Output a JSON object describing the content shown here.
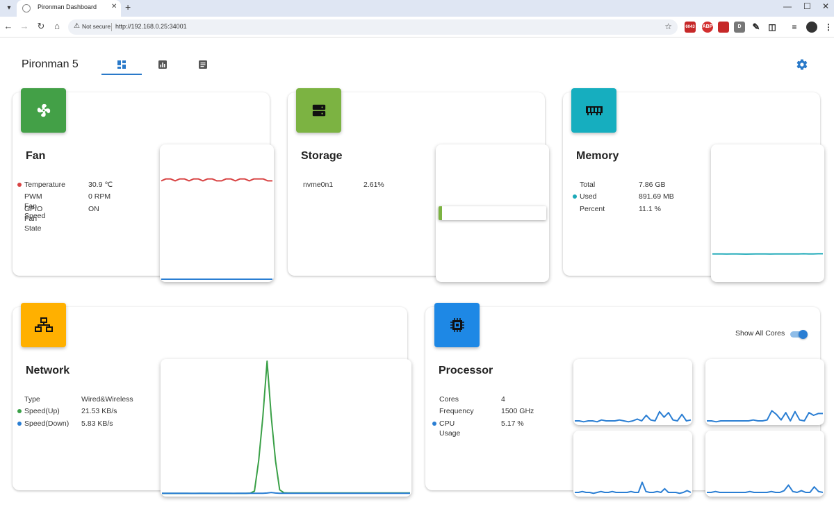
{
  "browser": {
    "tab_title": "Pironman Dashboard",
    "not_secure": "Not secure",
    "url": "http://192.168.0.25:34001",
    "extensions": [
      "6043",
      "ABP",
      "",
      "D"
    ]
  },
  "app": {
    "title": "Pironman 5",
    "nav_tabs": [
      "dashboard-icon",
      "chart-icon",
      "log-icon"
    ]
  },
  "fan": {
    "title": "Fan",
    "rows": [
      {
        "label": "Temperature",
        "value": "30.9 ℃",
        "dot": "#d84343"
      },
      {
        "label": "PWM Fan Speed",
        "value": "0 RPM",
        "dot": ""
      },
      {
        "label": "GPIO Fan State",
        "value": "ON",
        "dot": ""
      }
    ]
  },
  "storage": {
    "title": "Storage",
    "rows": [
      {
        "label": "nvme0n1",
        "value": "2.61%",
        "dot": ""
      }
    ],
    "usage_fraction": 0.0261
  },
  "memory": {
    "title": "Memory",
    "rows": [
      {
        "label": "Total",
        "value": "7.86 GB",
        "dot": ""
      },
      {
        "label": "Used",
        "value": "891.69 MB",
        "dot": "#1ca9b8"
      },
      {
        "label": "Percent",
        "value": "11.1 %",
        "dot": ""
      }
    ]
  },
  "network": {
    "title": "Network",
    "rows": [
      {
        "label": "Type",
        "value": "Wired&Wireless",
        "dot": ""
      },
      {
        "label": "Speed(Up)",
        "value": "21.53 KB/s",
        "dot": "#3aa047"
      },
      {
        "label": "Speed(Down)",
        "value": "5.83 KB/s",
        "dot": "#2a7ed3"
      }
    ]
  },
  "processor": {
    "title": "Processor",
    "rows": [
      {
        "label": "Cores",
        "value": "4",
        "dot": ""
      },
      {
        "label": "Frequency",
        "value": "1500 GHz",
        "dot": ""
      },
      {
        "label": "CPU Usage",
        "value": "5.17 %",
        "dot": "#2a7ed3"
      }
    ],
    "toggle_label": "Show All Cores",
    "show_all_cores": true
  },
  "colors": {
    "fan": "#43a047",
    "storage": "#7cb342",
    "memory": "#16aebf",
    "network": "#ffb000",
    "processor": "#1e88e5",
    "red": "#d84343",
    "blue": "#2a7ed3",
    "green": "#3aa047",
    "teal": "#1ca9b8",
    "accent": "#2979c9"
  },
  "chart_data": [
    {
      "type": "line",
      "name": "fan-temperature",
      "series": [
        {
          "color": "#d84343",
          "values": [
            49,
            50,
            50,
            49,
            50,
            50,
            49,
            50,
            50,
            49,
            50,
            50,
            49,
            49,
            50,
            50,
            49,
            50,
            50,
            49,
            50,
            50,
            50,
            49,
            49
          ]
        },
        {
          "color": "#2a7ed3",
          "values": [
            0,
            0,
            0,
            0,
            0,
            0,
            0,
            0,
            0,
            0,
            0,
            0,
            0,
            0,
            0,
            0,
            0,
            0,
            0,
            0,
            0,
            0,
            0,
            0,
            0
          ]
        }
      ],
      "ylim": [
        0,
        100
      ]
    },
    {
      "type": "line",
      "name": "memory-used",
      "series": [
        {
          "color": "#1ca9b8",
          "values": [
            11.1,
            11.1,
            11.1,
            11.0,
            11.1,
            11.1,
            11.0,
            10.9,
            11.0,
            11.1,
            11.1,
            11.1,
            11.0,
            11.1,
            11.1,
            11.1,
            11.1,
            11.1,
            11.1,
            11.2,
            11.1,
            11.1,
            11.2,
            11.2
          ]
        }
      ],
      "ylim": [
        0,
        100
      ]
    },
    {
      "type": "line",
      "name": "network-speed",
      "series": [
        {
          "color": "#3aa047",
          "values": [
            0.3,
            0.3,
            0.3,
            0.3,
            0.3,
            0.3,
            0.3,
            0.3,
            0.3,
            0.3,
            0.3,
            0.3,
            0.3,
            0.3,
            0.3,
            0.3,
            0.3,
            0.3,
            0.3,
            0.3,
            0.3,
            0.5,
            2,
            25,
            58,
            100,
            58,
            25,
            3,
            0.8,
            0.7,
            0.7,
            0.7,
            0.7,
            0.7,
            0.7,
            0.7,
            0.7,
            0.7,
            0.7,
            0.7,
            0.7,
            0.7,
            0.7,
            0.7,
            0.7,
            0.7,
            0.7,
            0.7,
            0.7,
            0.7,
            0.7,
            0.7,
            0.7,
            0.7,
            0.7,
            0.7,
            0.7,
            0.7,
            0.7
          ]
        },
        {
          "color": "#2a7ed3",
          "values": [
            0.4,
            0.4,
            0.4,
            0.4,
            0.4,
            0.4,
            0.4,
            0.3,
            0.3,
            0.4,
            0.4,
            0.4,
            0.3,
            0.3,
            0.4,
            0.4,
            0.4,
            0.3,
            0.4,
            0.4,
            0.4,
            0.4,
            0.4,
            0.4,
            0.4,
            0.6,
            1.0,
            0.6,
            0.4,
            0.4,
            0.4,
            0.4,
            0.4,
            0.4,
            0.4,
            0.4,
            0.4,
            0.4,
            0.4,
            0.4,
            0.4,
            0.4,
            0.4,
            0.4,
            0.4,
            0.4,
            0.4,
            0.4,
            0.4,
            0.4,
            0.4,
            0.4,
            0.4,
            0.4,
            0.4,
            0.4,
            0.4,
            0.4,
            0.4,
            0.4
          ]
        }
      ],
      "ylim": [
        0,
        100
      ]
    },
    {
      "type": "line",
      "name": "cpu-core-0",
      "series": [
        {
          "color": "#2a7ed3",
          "values": [
            3,
            3,
            2,
            3,
            3,
            2,
            4,
            3,
            3,
            3,
            4,
            3,
            2,
            3,
            5,
            3,
            9,
            4,
            3,
            13,
            7,
            12,
            4,
            3,
            10,
            3,
            4
          ]
        }
      ],
      "ylim": [
        0,
        100
      ]
    },
    {
      "type": "line",
      "name": "cpu-core-1",
      "series": [
        {
          "color": "#2a7ed3",
          "values": [
            3,
            3,
            2,
            3,
            3,
            3,
            3,
            3,
            3,
            3,
            4,
            3,
            3,
            4,
            14,
            10,
            4,
            12,
            3,
            13,
            4,
            3,
            12,
            9,
            11,
            11
          ]
        }
      ],
      "ylim": [
        0,
        100
      ]
    },
    {
      "type": "line",
      "name": "cpu-core-2",
      "series": [
        {
          "color": "#2a7ed3",
          "values": [
            3,
            3,
            4,
            3,
            3,
            2,
            3,
            4,
            3,
            3,
            4,
            3,
            3,
            3,
            3,
            4,
            3,
            3,
            14,
            4,
            3,
            3,
            4,
            3,
            7,
            3,
            3,
            3,
            2,
            3,
            5,
            3
          ]
        }
      ],
      "ylim": [
        0,
        100
      ]
    },
    {
      "type": "line",
      "name": "cpu-core-3",
      "series": [
        {
          "color": "#2a7ed3",
          "values": [
            3,
            3,
            4,
            3,
            3,
            3,
            3,
            3,
            3,
            3,
            4,
            3,
            3,
            3,
            3,
            4,
            3,
            3,
            5,
            11,
            4,
            3,
            5,
            3,
            3,
            9,
            4,
            3
          ]
        }
      ],
      "ylim": [
        0,
        100
      ]
    }
  ]
}
